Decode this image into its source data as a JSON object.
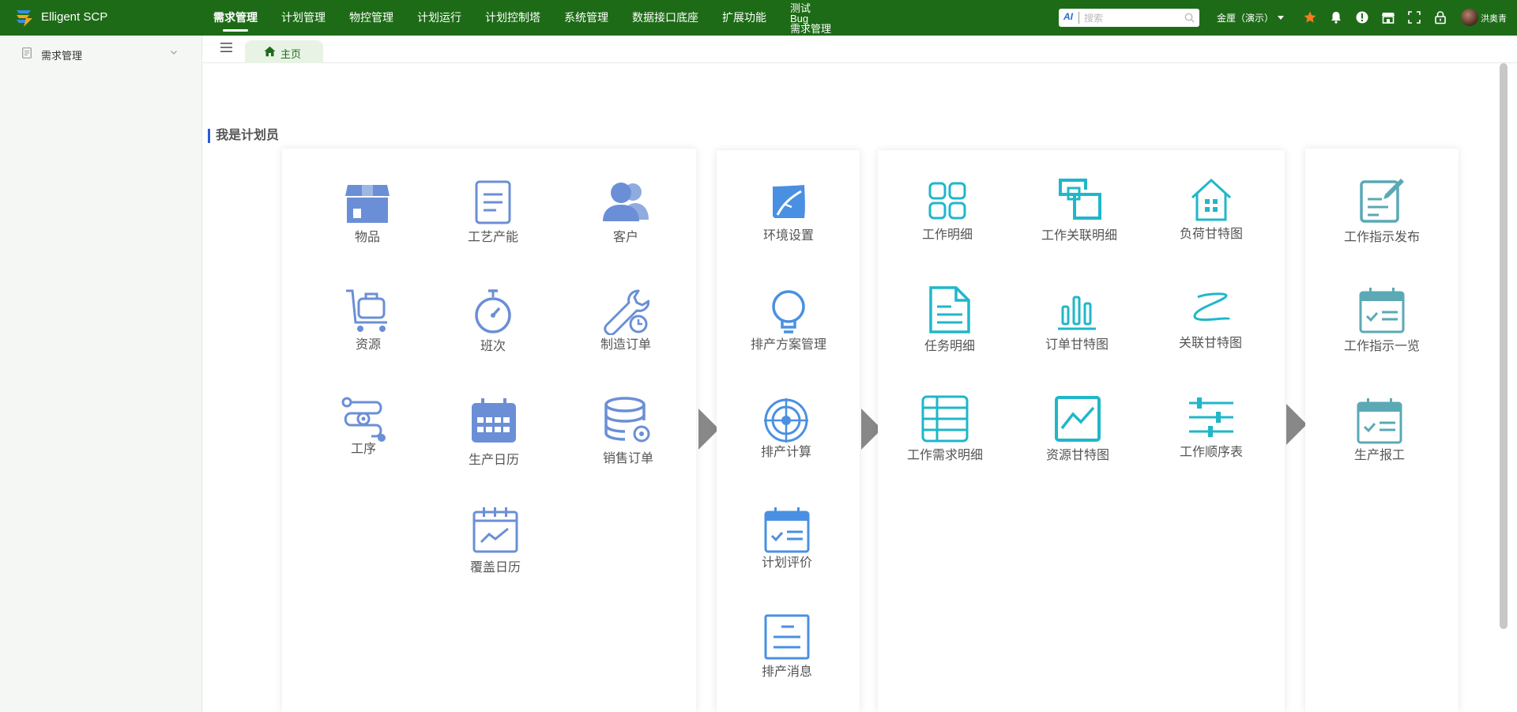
{
  "app": {
    "title": "Elligent SCP"
  },
  "nav": {
    "items": [
      "需求管理",
      "计划管理",
      "物控管理",
      "计划运行",
      "计划控制塔",
      "系统管理",
      "数据接口底座",
      "扩展功能"
    ],
    "stacked": [
      "测试",
      "Bug",
      "需求管理"
    ],
    "active": "需求管理"
  },
  "search": {
    "ai_label": "AI",
    "placeholder": "搜索"
  },
  "org": {
    "label": "金厘（演示）"
  },
  "user": {
    "name": "洪奥青"
  },
  "sidebar": {
    "items": [
      {
        "label": "需求管理"
      }
    ]
  },
  "tabs": {
    "home_label": "主页"
  },
  "section": {
    "title": "我是计划员"
  },
  "panels": {
    "p1": [
      "物品",
      "工艺产能",
      "客户",
      "资源",
      "班次",
      "制造订单",
      "工序",
      "生产日历",
      "销售订单",
      "覆盖日历"
    ],
    "p2": [
      "环境设置",
      "排产方案管理",
      "排产计算",
      "计划评价",
      "排产消息"
    ],
    "p3": [
      "工作明细",
      "工作关联明细",
      "负荷甘特图",
      "任务明细",
      "订单甘特图",
      "关联甘特图",
      "工作需求明细",
      "资源甘特图",
      "工作顺序表"
    ],
    "p4": [
      "工作指示发布",
      "工作指示一览",
      "生产报工"
    ]
  },
  "colors": {
    "topbar": "#1e6b17",
    "panel1_icon": "#6b8fd6",
    "panel2_icon": "#4a90e2",
    "panel3_icon": "#1fb7c9",
    "panel4_icon": "#5aa9b5",
    "star": "#f57c23",
    "section_bar": "#2a5bd7"
  }
}
